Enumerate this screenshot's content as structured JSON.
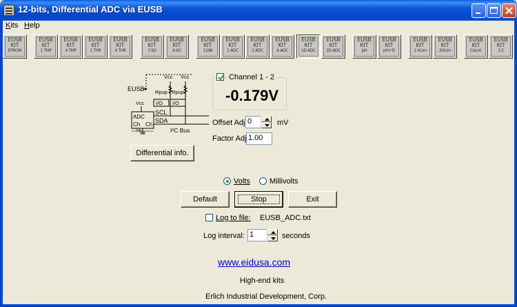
{
  "window": {
    "title": "12-bits, Differential ADC via EUSB"
  },
  "menu": [
    {
      "label": "Kits",
      "accel": "K",
      "rest": "its"
    },
    {
      "label": "Help",
      "accel": "H",
      "rest": "elp"
    }
  ],
  "toolbar": {
    "kits": [
      {
        "l1": "EUSB",
        "l2": "KIT",
        "l3": "EPROM"
      },
      {
        "l1": "EUSB",
        "l2": "KIT",
        "l3": "1 TMP"
      },
      {
        "l1": "EUSB",
        "l2": "KIT",
        "l3": "4 TMP"
      },
      {
        "l1": "EUSB",
        "l2": "KIT",
        "l3": "1 THR"
      },
      {
        "l1": "EUSB",
        "l2": "KIT",
        "l3": "4 THR"
      },
      {
        "l1": "EUSB",
        "l2": "KIT",
        "l3": "3 I\\O"
      },
      {
        "l1": "EUSB",
        "l2": "KIT",
        "l3": "6 I\\O"
      },
      {
        "l1": "EUSB",
        "l2": "KIT",
        "l3": "1296"
      },
      {
        "l1": "EUSB",
        "l2": "KIT",
        "l3": "1 ADC"
      },
      {
        "l1": "EUSB",
        "l2": "KIT",
        "l3": "2 ADC"
      },
      {
        "l1": "EUSB",
        "l2": "KIT",
        "l3": "4 ADC"
      },
      {
        "l1": "EUSB",
        "l2": "KIT",
        "l3": "1D ADC"
      },
      {
        "l1": "EUSB",
        "l2": "KIT",
        "l3": "2D ADC"
      },
      {
        "l1": "EUSB",
        "l2": "KIT",
        "l3": "pH"
      },
      {
        "l1": "EUSB",
        "l2": "KIT",
        "l3": "pH+Tc"
      },
      {
        "l1": "EUSB",
        "l2": "KIT",
        "l3": "1 Hi.Im"
      },
      {
        "l1": "EUSB",
        "l2": "KIT",
        "l3": "2Hi.Im"
      },
      {
        "l1": "EUSB",
        "l2": "KIT",
        "l3": "Count."
      },
      {
        "l1": "EUSB",
        "l2": "KIT",
        "l3": "3 Σ"
      }
    ]
  },
  "diagram": {
    "eusb": "EUSB",
    "vcc": "Vcc",
    "rpup": "Rpup",
    "io": "I/O",
    "scl": "SCL",
    "sda": "SDA",
    "adc": "ADC",
    "ch": "Ch",
    "dif": "DIF",
    "bus": "I²C Bus"
  },
  "diff_button": "Differential info.",
  "channel": {
    "label": "Channel 1 - 2",
    "checked": true,
    "reading": "-0.179V"
  },
  "offset": {
    "label": "Offset Adj.",
    "value": "0",
    "unit": "mV"
  },
  "factor": {
    "label": "Factor Adj.",
    "value": "1.00"
  },
  "units": {
    "volts": "Volts",
    "millivolts": "Millivolts",
    "selected": "Volts"
  },
  "buttons": {
    "default": "Default",
    "stop": "Stop",
    "exit": "Exit"
  },
  "log": {
    "label": "Log to file:",
    "filename": "EUSB_ADC.txt",
    "checked": false,
    "interval_label": "Log interval:",
    "interval_value": "1",
    "interval_unit": "seconds"
  },
  "footer": {
    "link": "www.eidusa.com",
    "tagline": "High-end kits",
    "company": "Erlich Industrial Development, Corp."
  }
}
